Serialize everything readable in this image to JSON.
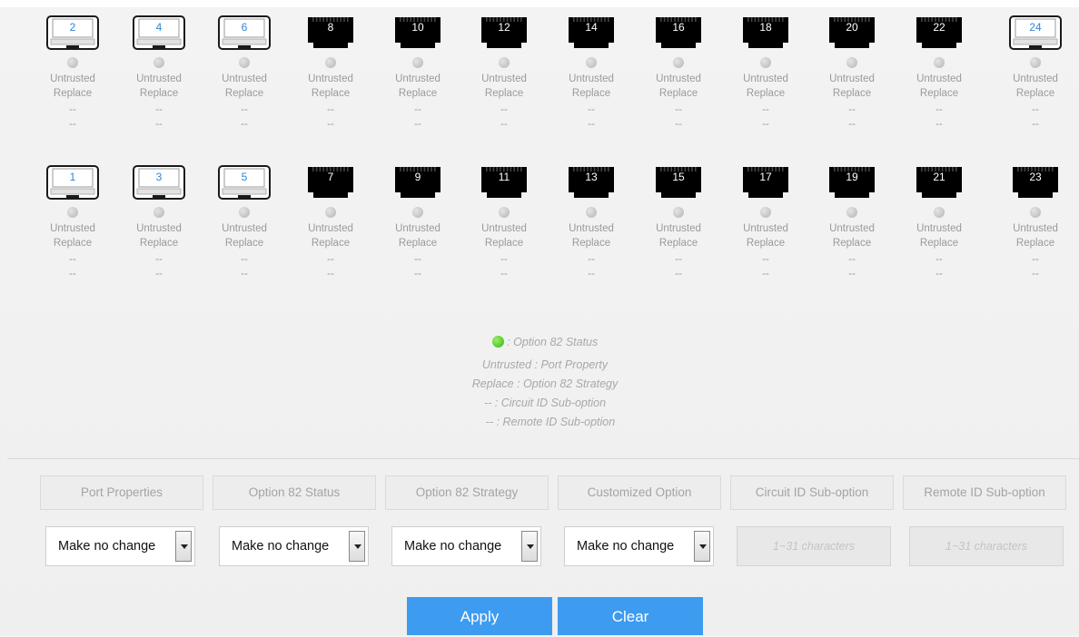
{
  "ports": [
    {
      "number": "2",
      "style": "light",
      "property": "Untrusted",
      "strategy": "Replace",
      "circuit_id": "--",
      "remote_id": "--"
    },
    {
      "number": "4",
      "style": "light",
      "property": "Untrusted",
      "strategy": "Replace",
      "circuit_id": "--",
      "remote_id": "--"
    },
    {
      "number": "6",
      "style": "light",
      "property": "Untrusted",
      "strategy": "Replace",
      "circuit_id": "--",
      "remote_id": "--"
    },
    {
      "number": "8",
      "style": "dark",
      "property": "Untrusted",
      "strategy": "Replace",
      "circuit_id": "--",
      "remote_id": "--"
    },
    {
      "number": "10",
      "style": "dark",
      "property": "Untrusted",
      "strategy": "Replace",
      "circuit_id": "--",
      "remote_id": "--"
    },
    {
      "number": "12",
      "style": "dark",
      "property": "Untrusted",
      "strategy": "Replace",
      "circuit_id": "--",
      "remote_id": "--"
    },
    {
      "number": "14",
      "style": "dark",
      "property": "Untrusted",
      "strategy": "Replace",
      "circuit_id": "--",
      "remote_id": "--"
    },
    {
      "number": "16",
      "style": "dark",
      "property": "Untrusted",
      "strategy": "Replace",
      "circuit_id": "--",
      "remote_id": "--"
    },
    {
      "number": "18",
      "style": "dark",
      "property": "Untrusted",
      "strategy": "Replace",
      "circuit_id": "--",
      "remote_id": "--"
    },
    {
      "number": "20",
      "style": "dark",
      "property": "Untrusted",
      "strategy": "Replace",
      "circuit_id": "--",
      "remote_id": "--"
    },
    {
      "number": "22",
      "style": "dark",
      "property": "Untrusted",
      "strategy": "Replace",
      "circuit_id": "--",
      "remote_id": "--"
    },
    {
      "number": "24",
      "style": "light",
      "property": "Untrusted",
      "strategy": "Replace",
      "circuit_id": "--",
      "remote_id": "--"
    },
    {
      "number": "1",
      "style": "light",
      "property": "Untrusted",
      "strategy": "Replace",
      "circuit_id": "--",
      "remote_id": "--"
    },
    {
      "number": "3",
      "style": "light",
      "property": "Untrusted",
      "strategy": "Replace",
      "circuit_id": "--",
      "remote_id": "--"
    },
    {
      "number": "5",
      "style": "light",
      "property": "Untrusted",
      "strategy": "Replace",
      "circuit_id": "--",
      "remote_id": "--"
    },
    {
      "number": "7",
      "style": "dark",
      "property": "Untrusted",
      "strategy": "Replace",
      "circuit_id": "--",
      "remote_id": "--"
    },
    {
      "number": "9",
      "style": "dark",
      "property": "Untrusted",
      "strategy": "Replace",
      "circuit_id": "--",
      "remote_id": "--"
    },
    {
      "number": "11",
      "style": "dark",
      "property": "Untrusted",
      "strategy": "Replace",
      "circuit_id": "--",
      "remote_id": "--"
    },
    {
      "number": "13",
      "style": "dark",
      "property": "Untrusted",
      "strategy": "Replace",
      "circuit_id": "--",
      "remote_id": "--"
    },
    {
      "number": "15",
      "style": "dark",
      "property": "Untrusted",
      "strategy": "Replace",
      "circuit_id": "--",
      "remote_id": "--"
    },
    {
      "number": "17",
      "style": "dark",
      "property": "Untrusted",
      "strategy": "Replace",
      "circuit_id": "--",
      "remote_id": "--"
    },
    {
      "number": "19",
      "style": "dark",
      "property": "Untrusted",
      "strategy": "Replace",
      "circuit_id": "--",
      "remote_id": "--"
    },
    {
      "number": "21",
      "style": "dark",
      "property": "Untrusted",
      "strategy": "Replace",
      "circuit_id": "--",
      "remote_id": "--"
    },
    {
      "number": "23",
      "style": "dark",
      "property": "Untrusted",
      "strategy": "Replace",
      "circuit_id": "--",
      "remote_id": "--"
    }
  ],
  "legend": {
    "status": ": Option 82 Status",
    "property": "Untrusted : Port Property",
    "strategy": "Replace : Option 82 Strategy",
    "circuit": "-- : Circuit ID Sub-option",
    "remote": "-- : Remote ID Sub-option"
  },
  "headers": [
    "Port Properties",
    "Option 82 Status",
    "Option 82 Strategy",
    "Customized Option",
    "Circuit ID Sub-option",
    "Remote ID Sub-option"
  ],
  "selects": [
    "Make no change",
    "Make no change",
    "Make no change",
    "Make no change"
  ],
  "inputs": {
    "circuit_placeholder": "1~31 characters",
    "remote_placeholder": "1~31 characters"
  },
  "buttons": {
    "apply": "Apply",
    "clear": "Clear"
  },
  "colors": {
    "accent": "#3d9bf0",
    "status_dot_on": "#4dc92a",
    "status_dot_off": "#c8c8c8",
    "port_up": "#ffffff",
    "port_down": "#000000"
  }
}
